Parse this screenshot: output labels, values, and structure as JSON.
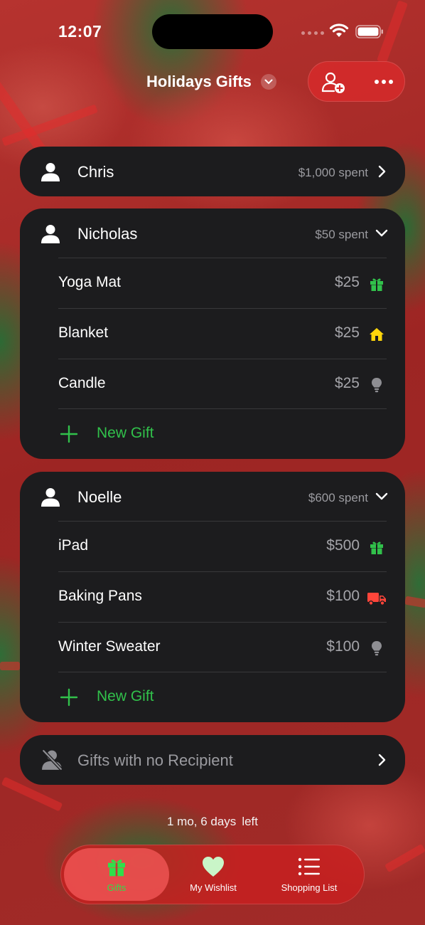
{
  "status_bar": {
    "time": "12:07"
  },
  "header": {
    "title": "Holidays Gifts"
  },
  "recipients": [
    {
      "name": "Chris",
      "spent": "$1,000 spent",
      "expanded": false,
      "gifts": []
    },
    {
      "name": "Nicholas",
      "spent": "$50 spent",
      "expanded": true,
      "gifts": [
        {
          "name": "Yoga Mat",
          "price": "$25",
          "status_icon": "gift-icon"
        },
        {
          "name": "Blanket",
          "price": "$25",
          "status_icon": "home-icon"
        },
        {
          "name": "Candle",
          "price": "$25",
          "status_icon": "lightbulb-icon"
        }
      ],
      "new_gift_label": "New Gift"
    },
    {
      "name": "Noelle",
      "spent": "$600 spent",
      "expanded": true,
      "gifts": [
        {
          "name": "iPad",
          "price": "$500",
          "status_icon": "gift-icon"
        },
        {
          "name": "Baking Pans",
          "price": "$100",
          "status_icon": "truck-icon"
        },
        {
          "name": "Winter Sweater",
          "price": "$100",
          "status_icon": "lightbulb-icon"
        }
      ],
      "new_gift_label": "New Gift"
    }
  ],
  "no_recipient": {
    "label": "Gifts with no Recipient"
  },
  "countdown": {
    "value": "1 mo, 6 days",
    "suffix": "left"
  },
  "tab_bar": {
    "tabs": [
      {
        "label": "Gifts",
        "icon": "gift-icon",
        "active": true
      },
      {
        "label": "My Wishlist",
        "icon": "heart-icon",
        "active": false
      },
      {
        "label": "Shopping List",
        "icon": "list-icon",
        "active": false
      }
    ]
  },
  "colors": {
    "accent_green": "#31c14b",
    "card_bg": "#1c1c1e",
    "gift_status": "#31c14b",
    "home_status": "#ffd60a",
    "truck_status": "#ff453a",
    "lightbulb_status": "#8e8e93",
    "header_action_bg": "#d62a2a"
  }
}
